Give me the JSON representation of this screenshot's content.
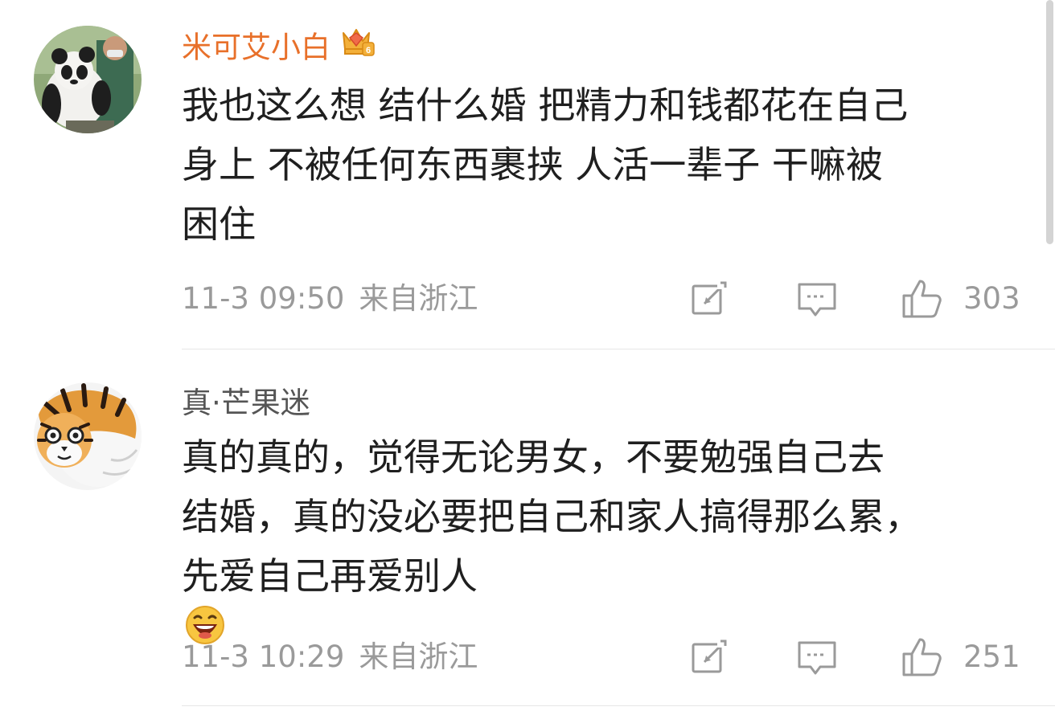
{
  "comments": [
    {
      "username": "米可艾小白",
      "user_badge": "crown-vip-6-icon",
      "content_lines": [
        "我也这么想 结什么婚 把精力和钱都花在自己",
        "身上 不被任何东西裹挟 人活一辈子 干嘛被",
        "困住"
      ],
      "time": "11-3 09:50",
      "source": "来自浙江",
      "likes": "303",
      "avatar": "panda-with-keeper-avatar"
    },
    {
      "username": "真·芒果迷",
      "content_lines": [
        "真的真的，觉得无论男女，不要勉强自己去",
        "结婚，真的没必要把自己和家人搞得那么累，",
        "先爱自己再爱别人"
      ],
      "emoji": "laughing-face-emoji",
      "time": "11-3 10:29",
      "source": "来自浙江",
      "likes": "251",
      "avatar": "tiger-cartoon-avatar"
    }
  ],
  "colors": {
    "vip_username": "#e8702a",
    "normal_username": "#555555",
    "meta_text": "#9a9a9a",
    "content_text": "#1f1f1f",
    "divider": "#e6e6e6"
  }
}
